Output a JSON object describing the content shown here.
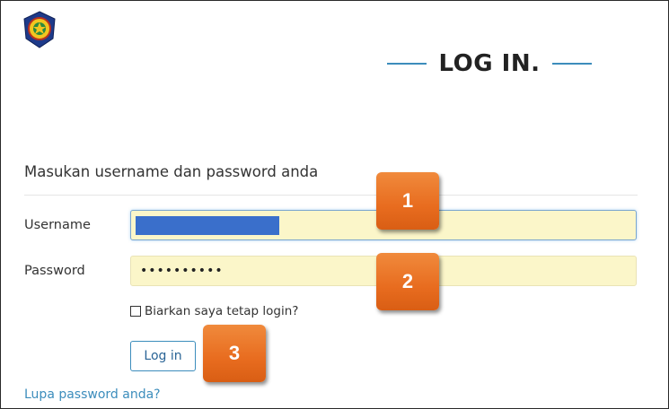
{
  "header": {
    "logo_icon": "institution-emblem-icon",
    "title": "LOG IN."
  },
  "form": {
    "subtitle": "Masukan username dan password anda",
    "username_label": "Username",
    "password_label": "Password",
    "password_value": "••••••••••",
    "remember_label": "Biarkan saya tetap login?",
    "login_button": "Log in",
    "forgot_link": "Lupa password anda?"
  },
  "steps": [
    "1",
    "2",
    "3"
  ],
  "colors": {
    "accent": "#3c8dbc",
    "input_fill": "#fbf6c9",
    "step_badge": "#e86c1f",
    "selection": "#3a6fcb"
  }
}
